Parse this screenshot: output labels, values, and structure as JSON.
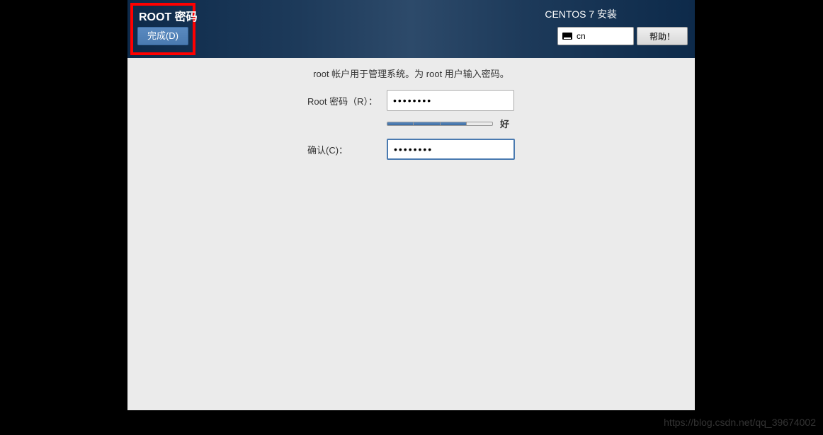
{
  "header": {
    "page_title": "ROOT 密码",
    "done_button": "完成(D)",
    "installer_title": "CENTOS 7 安装",
    "keyboard_layout": "cn",
    "help_button": "帮助！"
  },
  "content": {
    "instruction": "root 帐户用于管理系统。为 root 用户输入密码。",
    "root_password_label": "Root 密码（R）：",
    "root_password_value": "••••••••",
    "confirm_label": "确认(C)：",
    "confirm_value": "••••••••",
    "strength_label": "好",
    "strength_filled_segments": 3,
    "strength_total_segments": 4
  },
  "watermark": "https://blog.csdn.net/qq_39674002"
}
